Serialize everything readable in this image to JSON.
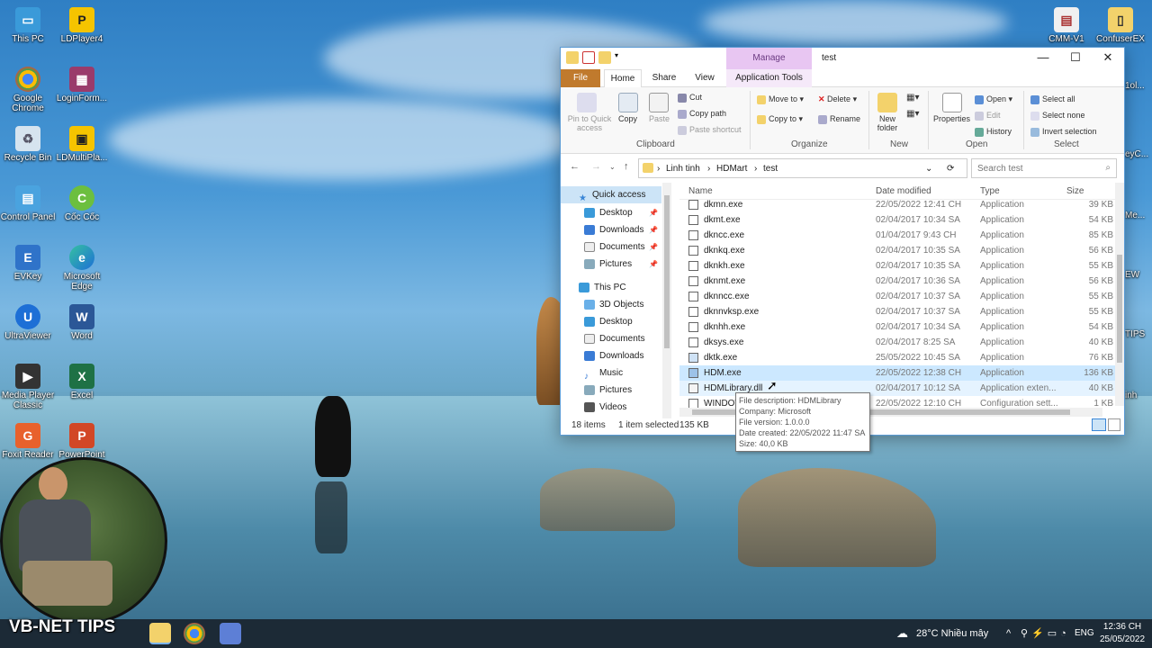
{
  "desktop": {
    "icons_left": [
      {
        "label": "This PC"
      },
      {
        "label": "Google Chrome"
      },
      {
        "label": "Recycle Bin"
      },
      {
        "label": "Control Panel"
      },
      {
        "label": "EVKey"
      },
      {
        "label": "UltraViewer"
      },
      {
        "label": "Media Player Classic"
      },
      {
        "label": "Foxit Reader"
      }
    ],
    "icons_col2": [
      {
        "label": "LDPlayer4"
      },
      {
        "label": "LoginForm..."
      },
      {
        "label": "LDMultiPla..."
      },
      {
        "label": "Cốc Cốc"
      },
      {
        "label": "Microsoft Edge"
      },
      {
        "label": "Word"
      },
      {
        "label": "Excel"
      },
      {
        "label": "PowerPoint"
      }
    ],
    "icons_right": [
      {
        "label": "CMM-V1"
      },
      {
        "label": "ConfuserEX"
      }
    ],
    "right_partial": [
      "1ol...",
      "eyC...",
      "Me...",
      "EW",
      "TIPS",
      "inh"
    ]
  },
  "explorer": {
    "title": "test",
    "manage_tab": "Manage",
    "tabs": [
      "File",
      "Home",
      "Share",
      "View",
      "Application Tools"
    ],
    "ribbon": {
      "pin_label": "Pin to Quick access",
      "copy_label": "Copy",
      "paste_label": "Paste",
      "cut_label": "Cut",
      "copy_path_label": "Copy path",
      "paste_shortcut_label": "Paste shortcut",
      "clipboard_group": "Clipboard",
      "move_to_label": "Move to",
      "copy_to_label": "Copy to",
      "delete_label": "Delete",
      "rename_label": "Rename",
      "organize_group": "Organize",
      "new_folder_label": "New folder",
      "new_group": "New",
      "properties_label": "Properties",
      "open_label": "Open",
      "edit_label": "Edit",
      "history_label": "History",
      "open_group": "Open",
      "select_all_label": "Select all",
      "select_none_label": "Select none",
      "invert_selection_label": "Invert selection",
      "select_group": "Select"
    },
    "breadcrumb": [
      "Linh tinh",
      "HDMart",
      "test"
    ],
    "search_placeholder": "Search test",
    "nav": {
      "quick_access": "Quick access",
      "quick_items": [
        "Desktop",
        "Downloads",
        "Documents",
        "Pictures"
      ],
      "this_pc": "This PC",
      "pc_items": [
        "3D Objects",
        "Desktop",
        "Documents",
        "Downloads",
        "Music",
        "Pictures",
        "Videos"
      ]
    },
    "columns": {
      "name": "Name",
      "date": "Date modified",
      "type": "Type",
      "size": "Size"
    },
    "files": [
      {
        "name": "dkmn.exe",
        "date": "22/05/2022 12:41 CH",
        "type": "Application",
        "size": "39 KB"
      },
      {
        "name": "dkmt.exe",
        "date": "02/04/2017 10:34 SA",
        "type": "Application",
        "size": "54 KB"
      },
      {
        "name": "dkncc.exe",
        "date": "01/04/2017 9:43 CH",
        "type": "Application",
        "size": "85 KB"
      },
      {
        "name": "dknkq.exe",
        "date": "02/04/2017 10:35 SA",
        "type": "Application",
        "size": "56 KB"
      },
      {
        "name": "dknkh.exe",
        "date": "02/04/2017 10:35 SA",
        "type": "Application",
        "size": "55 KB"
      },
      {
        "name": "dknmt.exe",
        "date": "02/04/2017 10:36 SA",
        "type": "Application",
        "size": "56 KB"
      },
      {
        "name": "dknncc.exe",
        "date": "02/04/2017 10:37 SA",
        "type": "Application",
        "size": "55 KB"
      },
      {
        "name": "dknnvksp.exe",
        "date": "02/04/2017 10:37 SA",
        "type": "Application",
        "size": "55 KB"
      },
      {
        "name": "dknhh.exe",
        "date": "02/04/2017 10:34 SA",
        "type": "Application",
        "size": "54 KB"
      },
      {
        "name": "dksys.exe",
        "date": "02/04/2017 8:25 SA",
        "type": "Application",
        "size": "40 KB"
      },
      {
        "name": "dktk.exe",
        "date": "25/05/2022 10:45 SA",
        "type": "Application",
        "size": "76 KB"
      },
      {
        "name": "HDM.exe",
        "date": "22/05/2022 12:38 CH",
        "type": "Application",
        "size": "136 KB"
      },
      {
        "name": "HDMLibrary.dll",
        "date": "02/04/2017 10:12 SA",
        "type": "Application exten...",
        "size": "40 KB"
      },
      {
        "name": "WINDOW",
        "date": "22/05/2022 12:10 CH",
        "type": "Configuration sett...",
        "size": "1 KB"
      }
    ],
    "status": {
      "count": "18 items",
      "selected": "1 item selected",
      "size": "135 KB"
    },
    "tooltip": [
      "File description: HDMLibrary",
      "Company: Microsoft",
      "File version: 1.0.0.0",
      "Date created: 22/05/2022 11:47 SA",
      "Size: 40,0 KB"
    ]
  },
  "overlay": {
    "brand": "VB-NET TIPS"
  },
  "taskbar": {
    "weather": "28°C  Nhiều mây",
    "lang": "ENG",
    "time": "12:36 CH",
    "date": "25/05/2022"
  }
}
